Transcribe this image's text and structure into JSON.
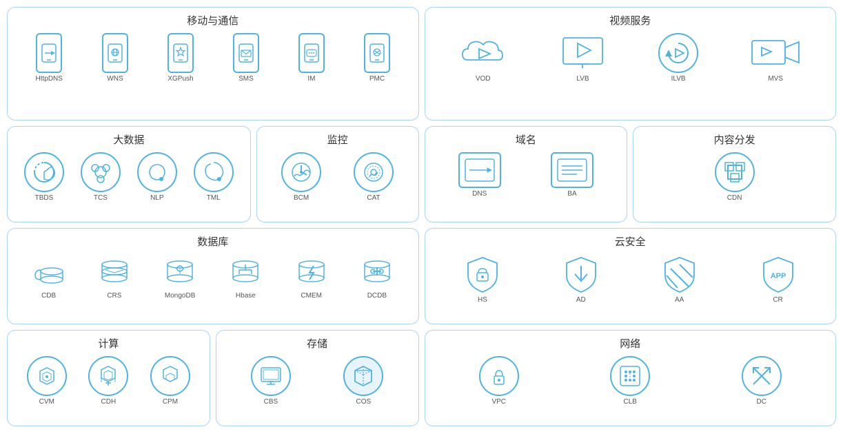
{
  "sections": {
    "mobile": {
      "title": "移动与通信",
      "items": [
        {
          "label": "HttpDNS",
          "icon": "httpdns"
        },
        {
          "label": "WNS",
          "icon": "wns"
        },
        {
          "label": "XGPush",
          "icon": "xgpush"
        },
        {
          "label": "SMS",
          "icon": "sms"
        },
        {
          "label": "IM",
          "icon": "im"
        },
        {
          "label": "PMC",
          "icon": "pmc"
        }
      ]
    },
    "video": {
      "title": "视频服务",
      "items": [
        {
          "label": "VOD",
          "icon": "vod"
        },
        {
          "label": "LVB",
          "icon": "lvb"
        },
        {
          "label": "ILVB",
          "icon": "ilvb"
        },
        {
          "label": "MVS",
          "icon": "mvs"
        }
      ]
    },
    "bigdata": {
      "title": "大数据",
      "items": [
        {
          "label": "TBDS",
          "icon": "tbds"
        },
        {
          "label": "TCS",
          "icon": "tcs"
        },
        {
          "label": "NLP",
          "icon": "nlp"
        },
        {
          "label": "TML",
          "icon": "tml"
        }
      ]
    },
    "monitor": {
      "title": "监控",
      "items": [
        {
          "label": "BCM",
          "icon": "bcm"
        },
        {
          "label": "CAT",
          "icon": "cat"
        }
      ]
    },
    "domain": {
      "title": "域名",
      "items": [
        {
          "label": "DNS",
          "icon": "dns"
        },
        {
          "label": "BA",
          "icon": "ba"
        }
      ]
    },
    "cdn": {
      "title": "内容分发",
      "items": [
        {
          "label": "CDN",
          "icon": "cdn"
        }
      ]
    },
    "database": {
      "title": "数据库",
      "items": [
        {
          "label": "CDB",
          "icon": "cdb"
        },
        {
          "label": "CRS",
          "icon": "crs"
        },
        {
          "label": "MongoDB",
          "icon": "mongodb"
        },
        {
          "label": "Hbase",
          "icon": "hbase"
        },
        {
          "label": "CMEM",
          "icon": "cmem"
        },
        {
          "label": "DCDB",
          "icon": "dcdb"
        }
      ]
    },
    "security": {
      "title": "云安全",
      "items": [
        {
          "label": "HS",
          "icon": "hs"
        },
        {
          "label": "AD",
          "icon": "ad"
        },
        {
          "label": "AA",
          "icon": "aa"
        },
        {
          "label": "CR",
          "icon": "cr"
        }
      ]
    },
    "compute": {
      "title": "计算",
      "items": [
        {
          "label": "CVM",
          "icon": "cvm"
        },
        {
          "label": "CDH",
          "icon": "cdh"
        },
        {
          "label": "CPM",
          "icon": "cpm"
        }
      ]
    },
    "storage": {
      "title": "存储",
      "items": [
        {
          "label": "CBS",
          "icon": "cbs"
        },
        {
          "label": "COS",
          "icon": "cos"
        }
      ]
    },
    "network": {
      "title": "网络",
      "items": [
        {
          "label": "VPC",
          "icon": "vpc"
        },
        {
          "label": "CLB",
          "icon": "clb"
        },
        {
          "label": "DC",
          "icon": "dc"
        }
      ]
    }
  }
}
